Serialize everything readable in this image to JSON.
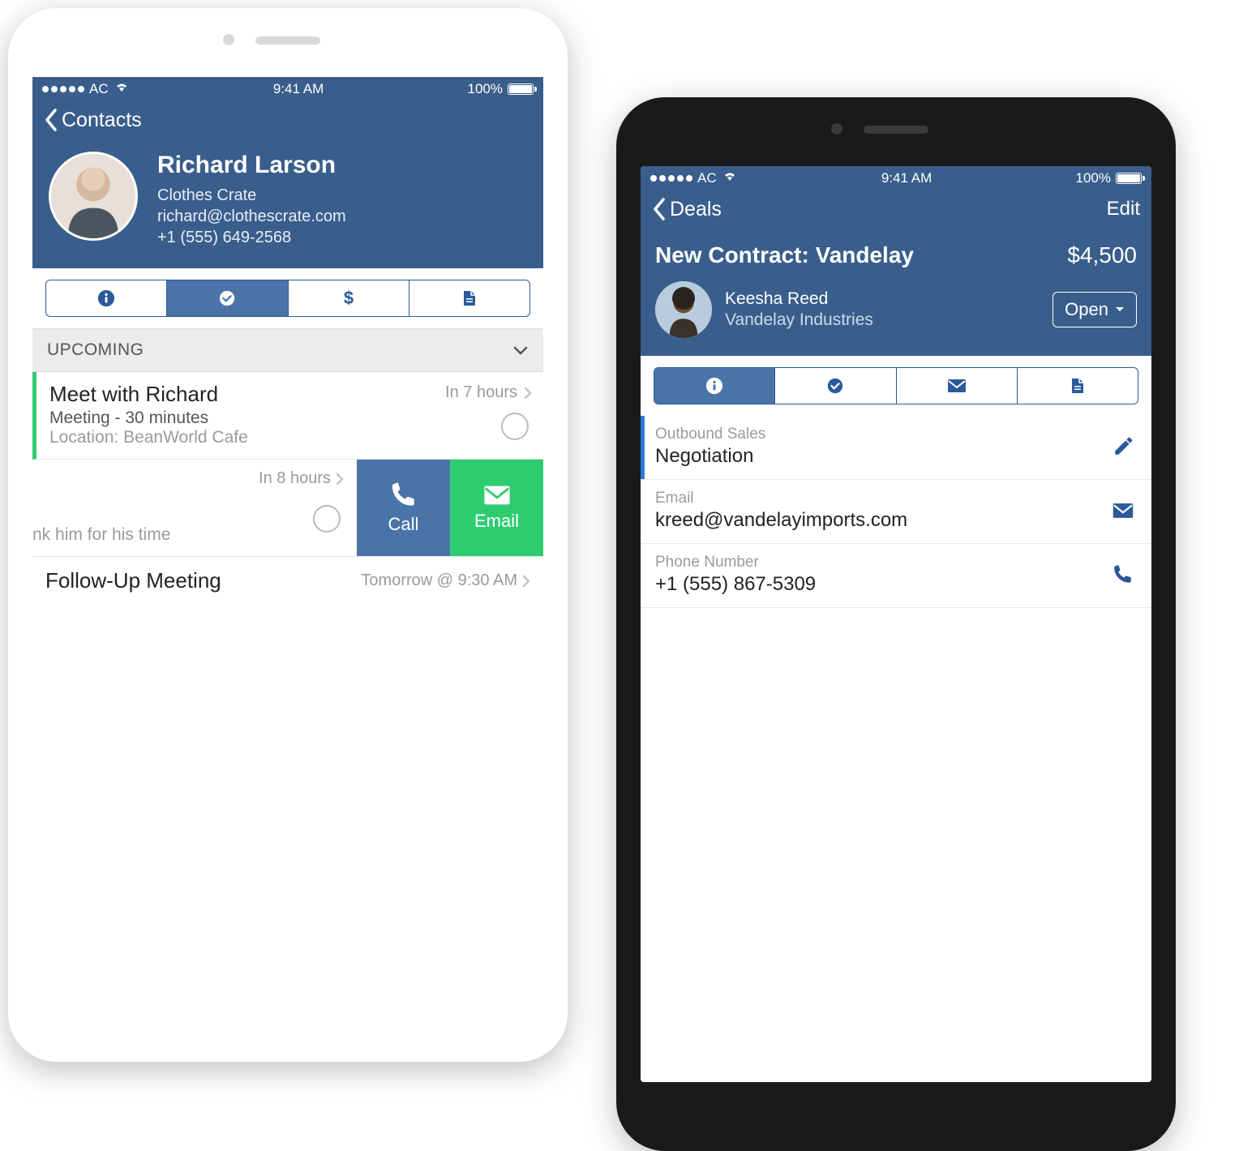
{
  "status": {
    "carrier": "AC",
    "time": "9:41 AM",
    "battery": "100%"
  },
  "phone1": {
    "back_label": "Contacts",
    "contact": {
      "name": "Richard Larson",
      "company": "Clothes Crate",
      "email": "richard@clothescrate.com",
      "phone": "+1 (555) 649-2568"
    },
    "section_header": "UPCOMING",
    "event": {
      "title": "Meet with Richard",
      "sub": "Meeting - 30 minutes",
      "location": "Location: BeanWorld Cafe",
      "when": "In 7 hours"
    },
    "swipe": {
      "when": "In 8 hours",
      "truncated": "nk him for his time",
      "call_label": "Call",
      "email_label": "Email"
    },
    "followup": {
      "title": "Follow-Up Meeting",
      "when": "Tomorrow @ 9:30 AM"
    }
  },
  "phone2": {
    "back_label": "Deals",
    "edit_label": "Edit",
    "deal": {
      "title": "New Contract: Vandelay",
      "amount": "$4,500",
      "contact_name": "Keesha Reed",
      "company": "Vandelay Industries",
      "status": "Open"
    },
    "fields": {
      "stage_label": "Outbound Sales",
      "stage_value": "Negotiation",
      "email_label": "Email",
      "email_value": "kreed@vandelayimports.com",
      "phone_label": "Phone Number",
      "phone_value": "+1 (555) 867-5309"
    }
  }
}
